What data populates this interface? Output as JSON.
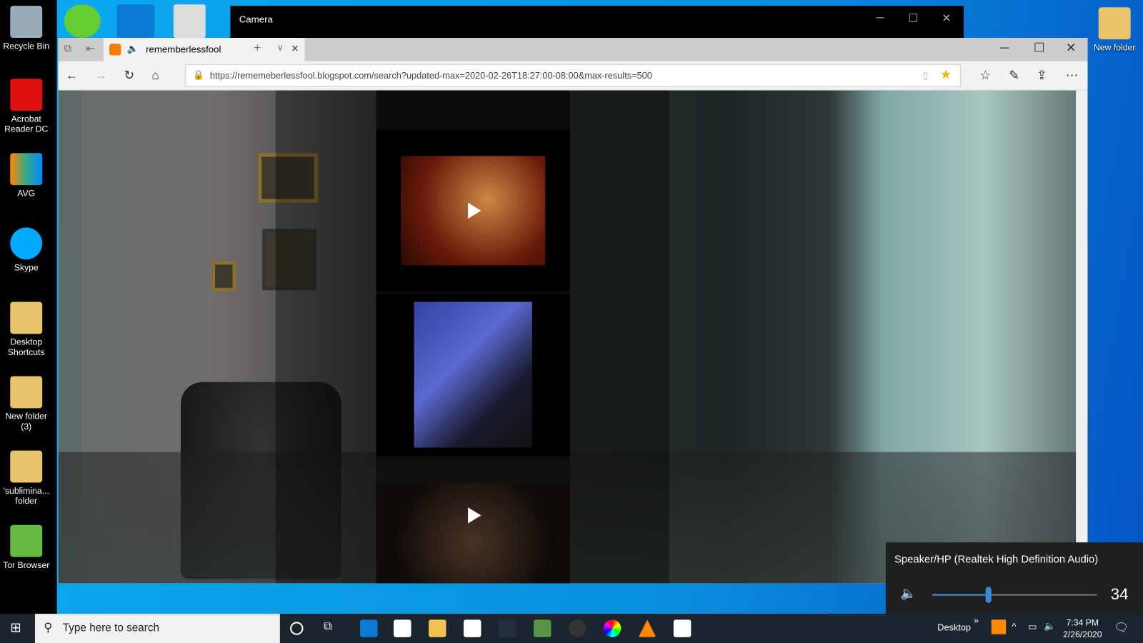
{
  "desktop": {
    "icons": [
      {
        "label": "Recycle Bin",
        "color": "#9ab"
      },
      {
        "label": "Acrobat Reader DC",
        "color": "#d11"
      },
      {
        "label": "AVG",
        "color": "#3a8"
      },
      {
        "label": "Skype",
        "color": "#0af"
      },
      {
        "label": "Desktop Shortcuts",
        "color": "#e9c46a"
      },
      {
        "label": "New folder (3)",
        "color": "#e9c46a"
      },
      {
        "label": "'sublimina... folder",
        "color": "#e9c46a"
      },
      {
        "label": "Tor Browser",
        "color": "#6b4"
      }
    ],
    "right_icon": "New folder"
  },
  "camera": {
    "title": "Camera"
  },
  "browser": {
    "tab_title": "rememberlessfool",
    "url": "https://rememeberlessfool.blogspot.com/search?updated-max=2020-02-26T18:27:00-08:00&max-results=500"
  },
  "volume": {
    "device": "Speaker/HP (Realtek High Definition Audio)",
    "level": 34
  },
  "taskbar": {
    "search_placeholder": "Type here to search",
    "desktop_label": "Desktop",
    "time": "7:34 PM",
    "date": "2/26/2020"
  }
}
